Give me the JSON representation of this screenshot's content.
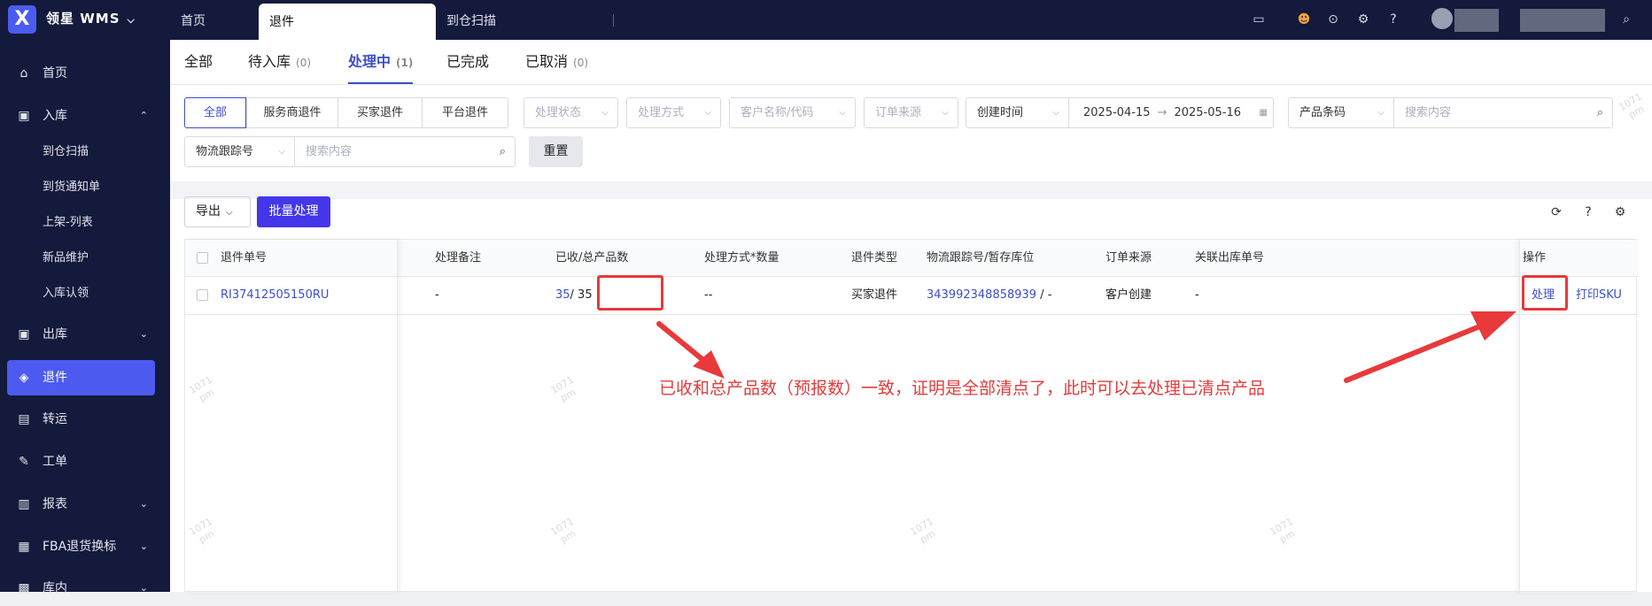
{
  "header": {
    "logo_glyph": "X",
    "brand": "领星  WMS",
    "brand_caret": "⌵",
    "tabs": [
      {
        "label": "首页"
      },
      {
        "label": "退件"
      },
      {
        "label": "到仓扫描"
      }
    ],
    "icons": [
      "inbox-icon",
      "robot-icon",
      "download-icon",
      "settings-icon",
      "help-icon",
      "search-icon"
    ]
  },
  "sidebar": {
    "items": [
      {
        "label": "首页",
        "icon": "home-icon"
      },
      {
        "label": "入库",
        "icon": "inbound-icon",
        "caret": "⌃"
      },
      {
        "label": "出库",
        "icon": "outbound-icon",
        "caret": "⌄"
      },
      {
        "label": "退件",
        "icon": "return-icon"
      },
      {
        "label": "转运",
        "icon": "transfer-icon"
      },
      {
        "label": "工单",
        "icon": "workorder-icon"
      },
      {
        "label": "报表",
        "icon": "report-icon",
        "caret": "⌄"
      },
      {
        "label": "FBA退货换标",
        "icon": "fba-icon",
        "caret": "⌄"
      },
      {
        "label": "库内",
        "icon": "warehouse-icon",
        "caret": "⌄"
      }
    ],
    "subitems": [
      "到仓扫描",
      "到货通知单",
      "上架-列表",
      "新品维护",
      "入库认领"
    ]
  },
  "status_tabs": [
    {
      "label": "全部",
      "count": ""
    },
    {
      "label": "待入库",
      "count": "(0)"
    },
    {
      "label": "处理中",
      "count": "(1)"
    },
    {
      "label": "已完成",
      "count": ""
    },
    {
      "label": "已取消",
      "count": "(0)"
    }
  ],
  "filters": {
    "segments": [
      "全部",
      "服务商退件",
      "买家退件",
      "平台退件"
    ],
    "process_status": "处理状态",
    "process_method": "处理方式",
    "customer": "客户名称/代码",
    "order_source": "订单来源",
    "time_type": "创建时间",
    "date_start": "2025-04-15",
    "date_arrow": "→",
    "date_end": "2025-05-16",
    "product_field": "产品条码",
    "search_placeholder": "搜索内容",
    "tracking_field": "物流跟踪号",
    "search_placeholder2": "搜索内容",
    "reset": "重置"
  },
  "toolbar": {
    "export": "导出",
    "batch": "批量处理"
  },
  "table": {
    "headers": [
      "退件单号",
      "处理备注",
      "已收/总产品数",
      "处理方式*数量",
      "退件类型",
      "物流跟踪号/暂存库位",
      "订单来源",
      "关联出库单号",
      "操作"
    ],
    "row": {
      "return_no": "RI37412505150RU",
      "remark": "-",
      "received": "35",
      "sep": "/ 35",
      "method": "--",
      "type": "买家退件",
      "tracking": "343992348858939",
      "tracking_suffix": " / -",
      "source": "客户创建",
      "outbound": "-",
      "action_process": "处理",
      "action_print": "打印SKU"
    }
  },
  "annotation": "已收和总产品数（预报数）一致，证明是全部清点了，此时可以去处理已清点产品",
  "watermark": [
    "1071",
    "pm"
  ],
  "colors": {
    "topbar": "#131a3b",
    "accent": "#4c5af0",
    "link": "#3b4fc9",
    "highlight": "#e8393b"
  }
}
